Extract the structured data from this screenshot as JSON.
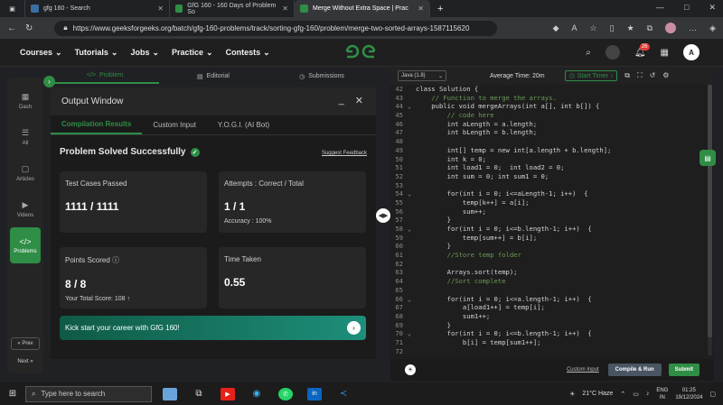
{
  "browser": {
    "tabs": [
      {
        "label": "gfg 160 - Search",
        "active": false
      },
      {
        "label": "GfG 160 - 160 Days of Problem So",
        "active": false
      },
      {
        "label": "Merge Without Extra Space | Prac",
        "active": true
      }
    ],
    "new_tab": "+",
    "url": "https://www.geeksforgeeks.org/batch/gfg-160-problems/track/sorting-gfg-160/problem/merge-two-sorted-arrays-1587115620",
    "window_controls": [
      "—",
      "□",
      "✕"
    ]
  },
  "gfg_nav": {
    "items": [
      "Courses",
      "Tutorials",
      "Jobs",
      "Practice",
      "Contests"
    ],
    "logo": "GG",
    "notification_count": "26",
    "user_initial": "A"
  },
  "sidebar": {
    "items": [
      "Dash",
      "All",
      "Articles",
      "Videos",
      "Problems"
    ],
    "prev": "« Prev",
    "next": "Next »"
  },
  "problem_tabs": [
    "Problem",
    "Editorial",
    "Submissions"
  ],
  "output": {
    "title": "Output Window",
    "tabs": [
      "Compilation Results",
      "Custom Input",
      "Y.O.G.I. (AI Bot)"
    ],
    "status": "Problem Solved Successfully",
    "feedback": "Suggest Feedback",
    "cards": {
      "test_cases_label": "Test Cases Passed",
      "test_cases_value": "1111 / 1111",
      "attempts_label": "Attempts : Correct / Total",
      "attempts_value": "1 / 1",
      "accuracy": "Accuracy : 100%",
      "points_label": "Points Scored",
      "points_value": "8 / 8",
      "total_score": "Your Total Score: 108 ↑",
      "time_label": "Time Taken",
      "time_value": "0.55"
    },
    "banner": "Kick start your career with GfG 160!"
  },
  "editor": {
    "language": "Java (1.8)",
    "average_time": "Average Time: 20m",
    "start_timer": "Start Timer",
    "lines": [
      {
        "n": "42",
        "t": "class Solution {"
      },
      {
        "n": "43",
        "t": "    // Function to merge the arrays."
      },
      {
        "n": "44",
        "t": "    public void mergeArrays(int a[], int b[]) {"
      },
      {
        "n": "45",
        "t": "        // code here"
      },
      {
        "n": "46",
        "t": "        int aLength = a.length;"
      },
      {
        "n": "47",
        "t": "        int bLength = b.length;"
      },
      {
        "n": "48",
        "t": ""
      },
      {
        "n": "49",
        "t": "        int[] temp = new int[a.length + b.length];"
      },
      {
        "n": "50",
        "t": "        int k = 0;"
      },
      {
        "n": "51",
        "t": "        int load1 = 0;  int load2 = 0;"
      },
      {
        "n": "52",
        "t": "        int sum = 0; int sum1 = 0;"
      },
      {
        "n": "53",
        "t": ""
      },
      {
        "n": "54",
        "t": "        for(int i = 0; i<=aLength-1; i++)  {"
      },
      {
        "n": "55",
        "t": "            temp[k++] = a[i];"
      },
      {
        "n": "56",
        "t": "            sum++;"
      },
      {
        "n": "57",
        "t": "        }"
      },
      {
        "n": "58",
        "t": "        for(int i = 0; i<=b.length-1; i++)  {"
      },
      {
        "n": "59",
        "t": "            temp[sum++] = b[i];"
      },
      {
        "n": "60",
        "t": "        }"
      },
      {
        "n": "61",
        "t": "        //Store temp folder"
      },
      {
        "n": "62",
        "t": ""
      },
      {
        "n": "63",
        "t": "        Arrays.sort(temp);"
      },
      {
        "n": "64",
        "t": "        //Sort complete"
      },
      {
        "n": "65",
        "t": ""
      },
      {
        "n": "66",
        "t": "        for(int i = 0; i<=a.length-1; i++)  {"
      },
      {
        "n": "67",
        "t": "            a[load1++] = temp[i];"
      },
      {
        "n": "68",
        "t": "            sum1++;"
      },
      {
        "n": "69",
        "t": "        }"
      },
      {
        "n": "70",
        "t": "        for(int i = 0; i<=b.length-1; i++)  {"
      },
      {
        "n": "71",
        "t": "            b[i] = temp[sum1++];"
      },
      {
        "n": "72",
        "t": ""
      }
    ],
    "custom_input": "Custom Input",
    "compile_run": "Compile & Run",
    "submit": "Submit"
  },
  "taskbar": {
    "search_placeholder": "Type here to search",
    "weather": "21°C  Haze",
    "lang": "ENG",
    "lang_region": "IN",
    "time": "01:25",
    "date": "19/12/2024"
  },
  "colors": {
    "brand": "#2f8d46",
    "bg": "#1b1b1b"
  }
}
